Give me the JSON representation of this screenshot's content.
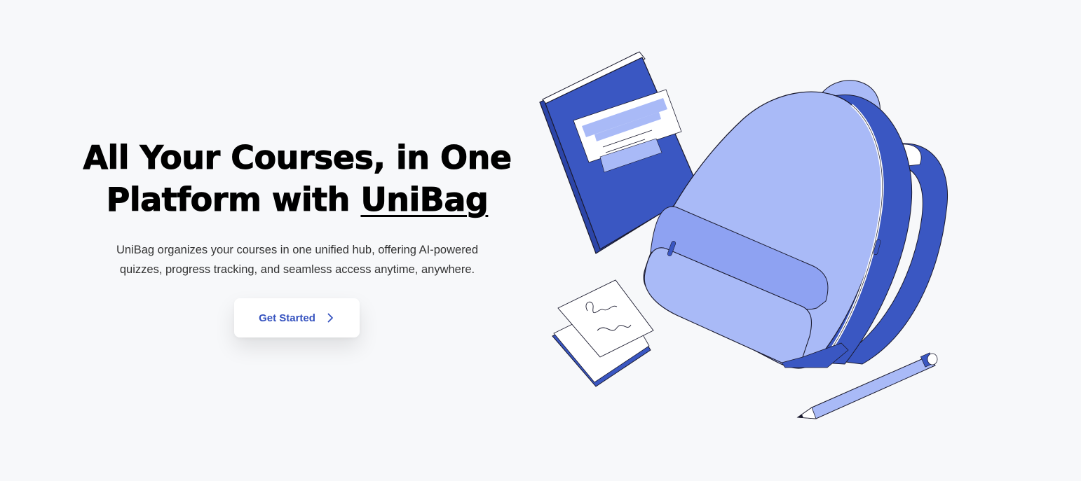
{
  "hero": {
    "headline_line1": "All Your Courses, in One",
    "headline_line2_prefix": "Platform with ",
    "headline_brand": "UniBag",
    "description": "UniBag organizes your courses in one unified hub, offering AI-powered quizzes, progress tracking, and seamless access anytime, anywhere.",
    "cta_label": "Get Started",
    "cta_icon": "chevron-right-icon"
  },
  "illustration": {
    "subject": "backpack-book-notes-pencil",
    "colors": {
      "primary_blue": "#3a57c2",
      "light_blue": "#a9baf7",
      "pale_blue": "#c4d0fa",
      "paper": "#ffffff",
      "outline": "#1a1a2e"
    }
  },
  "colors": {
    "background": "#f7f8fa",
    "headline": "#000000",
    "body_text": "#333333",
    "accent": "#3552bf"
  }
}
